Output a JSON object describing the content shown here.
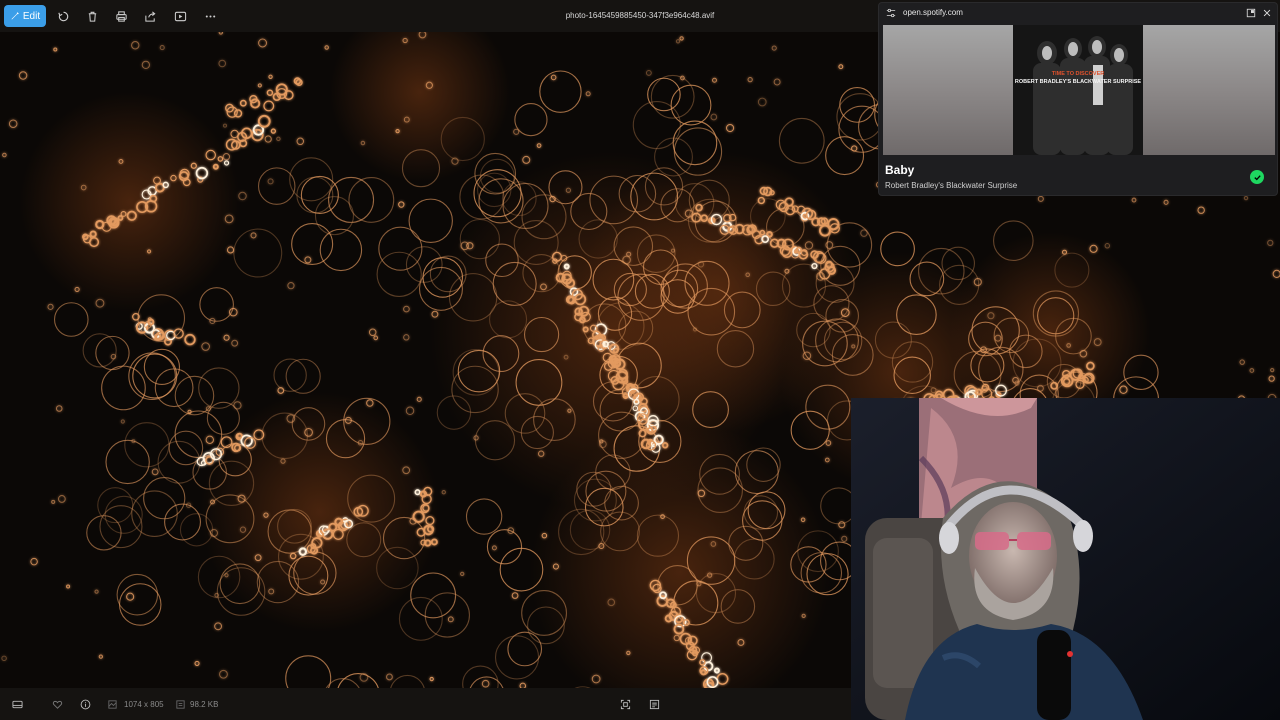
{
  "toolbar": {
    "edit_label": "Edit",
    "file_name": "photo-1645459885450-347f3e964c48.avif",
    "icons": [
      "rotate-icon",
      "delete-icon",
      "print-icon",
      "share-icon",
      "slideshow-icon",
      "more-icon"
    ]
  },
  "statusbar": {
    "dimensions": "1074 x 805",
    "file_size": "98.2 KB",
    "icons": [
      "filmstrip-icon",
      "favorite-icon",
      "info-icon",
      "dimensions-icon",
      "filesize-icon",
      "fit-icon",
      "actual-size-icon"
    ]
  },
  "mini_player": {
    "url": "open.spotify.com",
    "track_title": "Baby",
    "artist": "Robert Bradley's Blackwater Surprise",
    "album_cover_text_1": "TIME TO DISCOVER",
    "album_cover_text_2": "ROBERT BRADLEY'S BLACKWATER SURPRISE",
    "saved": true,
    "accent_color": "#1ed760"
  },
  "colors": {
    "accent": "#3b9ee8",
    "bokeh": "#e39a5f",
    "toolbar_bg": "#151311"
  }
}
